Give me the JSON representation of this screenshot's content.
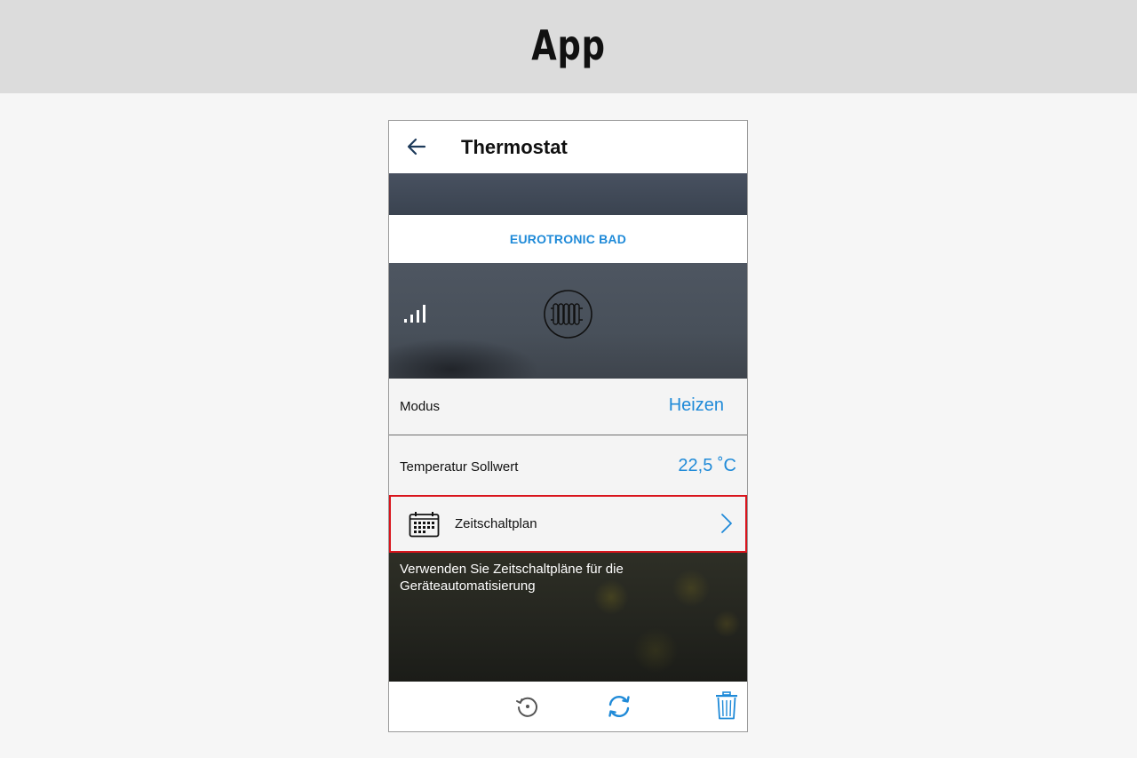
{
  "banner": {
    "title": "App"
  },
  "appbar": {
    "title": "Thermostat",
    "back_icon": "arrow-left-icon"
  },
  "device": {
    "name": "EUROTRONIC BAD"
  },
  "hero": {
    "signal_icon": "signal-strength-icon",
    "device_icon": "radiator-icon"
  },
  "modus": {
    "label": "Modus",
    "value": "Heizen"
  },
  "temperature": {
    "label": "Temperatur Sollwert",
    "value": "22,5 ˚C"
  },
  "schedule": {
    "label": "Zeitschaltplan",
    "icon": "calendar-icon",
    "highlight_color": "#d9141c"
  },
  "info": {
    "text": "Verwenden Sie Zeitschaltpläne für die Geräteautomatisierung"
  },
  "toolbar": {
    "icons": [
      "history-icon",
      "sync-icon",
      "trash-icon"
    ]
  },
  "colors": {
    "accent": "#1f8ad8",
    "highlight": "#d9141c"
  }
}
